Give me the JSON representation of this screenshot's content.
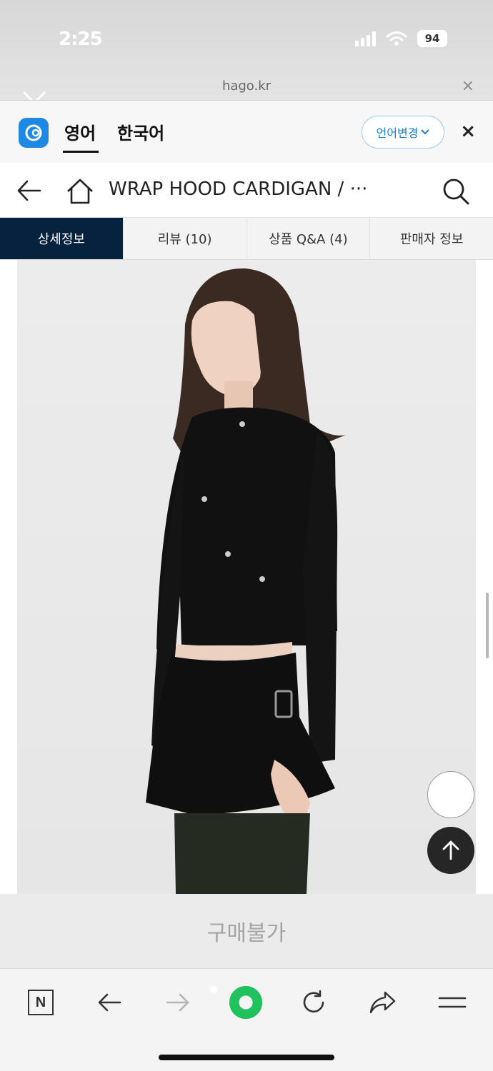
{
  "status_bar": {
    "time": "2:25",
    "battery": "94"
  },
  "url_bar": {
    "domain": "hago.kr",
    "close": "×"
  },
  "translate_bar": {
    "source_lang": "영어",
    "target_lang": "한국어",
    "change_button": "언어변경",
    "close": "×"
  },
  "header": {
    "title": "WRAP HOOD CARDIGAN / ···"
  },
  "tabs": [
    {
      "label": "상세정보",
      "active": true
    },
    {
      "label": "리뷰 (10)",
      "active": false
    },
    {
      "label": "상품 Q&A (4)",
      "active": false
    },
    {
      "label": "판매자 정보",
      "active": false
    }
  ],
  "purchase": {
    "label": "구매불가"
  },
  "toolbar": {
    "n_label": "N"
  },
  "colors": {
    "active_tab": "#07223f",
    "papago_blue": "#1e88e5",
    "lang_change_text": "#1b7cc9"
  }
}
